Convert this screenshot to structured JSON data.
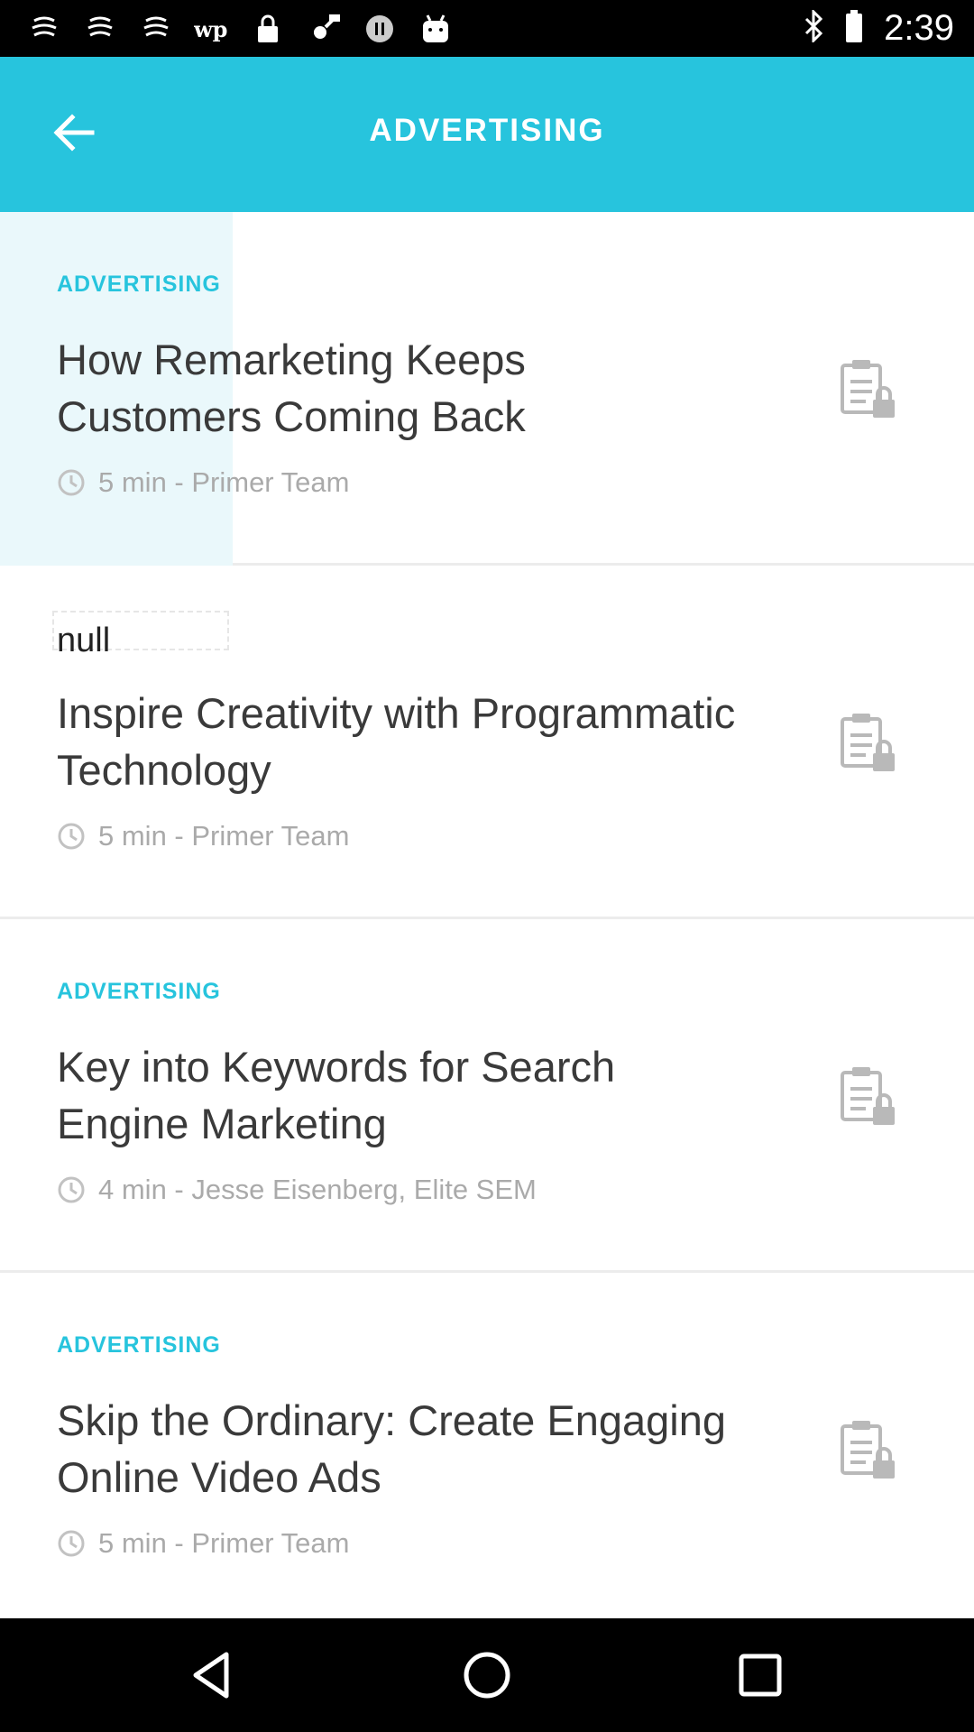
{
  "status_bar": {
    "time": "2:39",
    "left_icons": [
      "notification-icon",
      "notification-icon",
      "notification-icon",
      "wp-icon",
      "lock-icon",
      "fake-gps-icon",
      "pause-circle-icon",
      "android-icon"
    ],
    "right_icons": [
      "bluetooth-icon"
    ]
  },
  "app_bar": {
    "title": "ADVERTISING",
    "background": "#27c4dd"
  },
  "articles": [
    {
      "category": "ADVERTISING",
      "title": "How Remarketing Keeps Customers Coming Back",
      "meta": "5 min - Primer Team"
    },
    {
      "category": "null",
      "title": "Inspire Creativity with Programmatic Technology",
      "meta": "5 min - Primer Team"
    },
    {
      "category": "ADVERTISING",
      "title": "Key into Keywords for Search Engine Marketing",
      "meta": "4 min - Jesse Eisenberg, Elite SEM"
    },
    {
      "category": "ADVERTISING",
      "title": "Skip the Ordinary: Create Engaging Online Video Ads",
      "meta": "5 min - Primer Team"
    }
  ],
  "nav_bar": {
    "buttons": [
      "back-triangle-icon",
      "home-circle-icon",
      "recents-square-icon"
    ]
  },
  "colors": {
    "accent": "#27c4dd",
    "highlight": "#eaf8fb",
    "meta_text": "#aaaaaa"
  }
}
